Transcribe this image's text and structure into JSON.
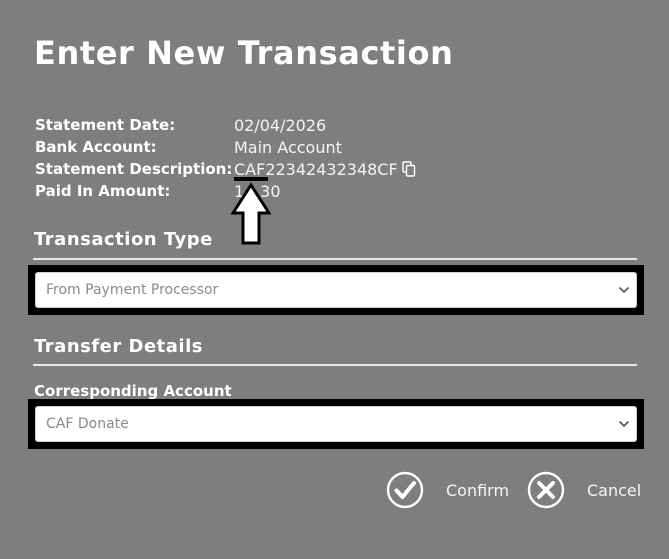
{
  "dialog": {
    "title": "Enter New Transaction"
  },
  "details": {
    "statement_date_label": "Statement Date:",
    "statement_date_value": "02/04/2026",
    "bank_account_label": "Bank Account:",
    "bank_account_value": "Main Account",
    "statement_description_label": "Statement Description:",
    "statement_description_value": "CAF22342432348CF",
    "paid_in_label": "Paid In Amount:",
    "paid_in_value": "1__30"
  },
  "transaction_type": {
    "heading": "Transaction Type",
    "selected": "From Payment Processor"
  },
  "transfer_details": {
    "heading": "Transfer Details",
    "corresponding_account_label": "Corresponding Account",
    "corresponding_account_selected": "CAF Donate"
  },
  "actions": {
    "confirm_label": "Confirm",
    "cancel_label": "Cancel"
  },
  "icons": {
    "copy": "copy-icon",
    "arrow": "arrow-up-to-line-icon",
    "chevron": "chevron-down-icon",
    "confirm": "check-circle-icon",
    "cancel": "x-circle-icon"
  },
  "colors": {
    "background": "#7e7e7e",
    "text": "#ffffff",
    "outline": "#000000"
  }
}
